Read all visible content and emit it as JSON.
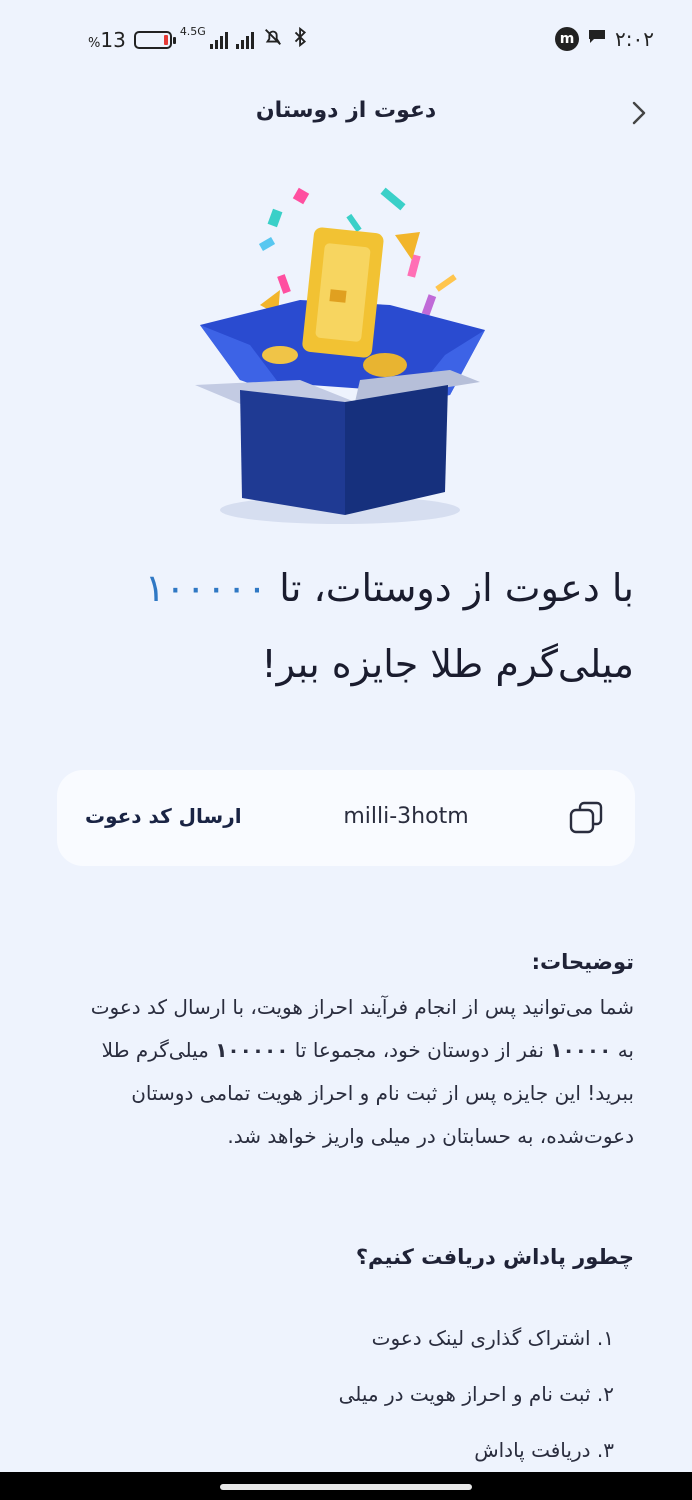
{
  "status_bar": {
    "battery_percent": "13",
    "percent_sign": "%",
    "network": "4.5G",
    "time": "۲:۰۲"
  },
  "header": {
    "title": "دعوت از دوستان"
  },
  "headline": {
    "part1": "با دعوت از دوستات، تا ",
    "amount": "۱۰۰۰۰۰",
    "part2": "میلی‌گرم طلا جایزه ببر!"
  },
  "invite": {
    "send_label": "ارسال کد دعوت",
    "code": "milli-3hotm"
  },
  "description": {
    "title": "توضیحات:",
    "text_1": "شما می‌توانید پس از انجام فرآیند احراز هویت، با ارسال کد دعوت به ",
    "bold_1": "۱۰۰۰۰",
    "text_2": " نفر از دوستان خود، مجموعا تا ",
    "bold_2": "۱۰۰۰۰۰",
    "text_3": " میلی‌گرم طلا ببرید! این جایزه پس از ثبت نام و احراز هویت تمامی دوستان دعوت‌شده، به حسابتان در میلی واریز خواهد شد."
  },
  "how": {
    "title": "چطور پاداش دریافت کنیم؟",
    "steps": [
      "۱. اشتراک گذاری لینک دعوت",
      "۲. ثبت نام و احراز هویت در میلی",
      "۳. دریافت پاداش"
    ]
  },
  "colors": {
    "accent": "#2f78c4",
    "box": "#1f3a93",
    "gold": "#f2c233",
    "background": "#eef3fd"
  }
}
